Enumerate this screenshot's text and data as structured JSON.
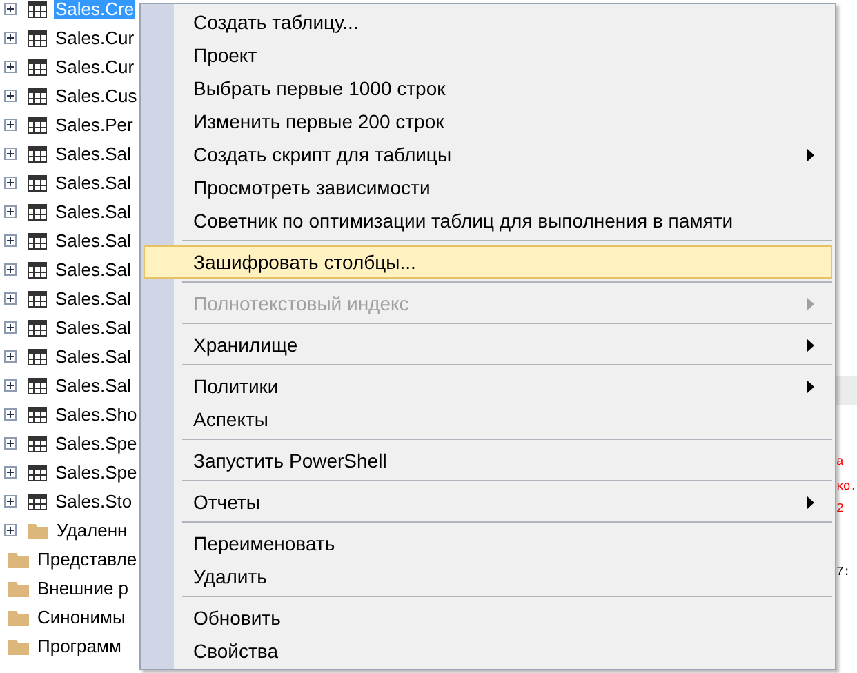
{
  "tree": {
    "nested_items": [
      {
        "label": "Sales.Cre",
        "kind": "table",
        "expandable": true,
        "selected": true
      },
      {
        "label": "Sales.Cur",
        "kind": "table",
        "expandable": true,
        "selected": false
      },
      {
        "label": "Sales.Cur",
        "kind": "table",
        "expandable": true,
        "selected": false
      },
      {
        "label": "Sales.Cus",
        "kind": "table",
        "expandable": true,
        "selected": false
      },
      {
        "label": "Sales.Per",
        "kind": "table",
        "expandable": true,
        "selected": false
      },
      {
        "label": "Sales.Sal",
        "kind": "table",
        "expandable": true,
        "selected": false
      },
      {
        "label": "Sales.Sal",
        "kind": "table",
        "expandable": true,
        "selected": false
      },
      {
        "label": "Sales.Sal",
        "kind": "table",
        "expandable": true,
        "selected": false
      },
      {
        "label": "Sales.Sal",
        "kind": "table",
        "expandable": true,
        "selected": false
      },
      {
        "label": "Sales.Sal",
        "kind": "table",
        "expandable": true,
        "selected": false
      },
      {
        "label": "Sales.Sal",
        "kind": "table",
        "expandable": true,
        "selected": false
      },
      {
        "label": "Sales.Sal",
        "kind": "table",
        "expandable": true,
        "selected": false
      },
      {
        "label": "Sales.Sal",
        "kind": "table",
        "expandable": true,
        "selected": false
      },
      {
        "label": "Sales.Sal",
        "kind": "table",
        "expandable": true,
        "selected": false
      },
      {
        "label": "Sales.Sho",
        "kind": "table",
        "expandable": true,
        "selected": false
      },
      {
        "label": "Sales.Spe",
        "kind": "table",
        "expandable": true,
        "selected": false
      },
      {
        "label": "Sales.Spe",
        "kind": "table",
        "expandable": true,
        "selected": false
      },
      {
        "label": "Sales.Sto",
        "kind": "table",
        "expandable": true,
        "selected": false
      },
      {
        "label": "Удаленн",
        "kind": "folder",
        "expandable": true,
        "selected": false
      }
    ],
    "items": [
      {
        "label": "Представле",
        "kind": "folder",
        "expandable": false,
        "selected": false
      },
      {
        "label": "Внешние р",
        "kind": "folder",
        "expandable": false,
        "selected": false
      },
      {
        "label": "Синонимы",
        "kind": "folder",
        "expandable": false,
        "selected": false
      },
      {
        "label": "Программ",
        "kind": "folder",
        "expandable": false,
        "selected": false
      }
    ]
  },
  "editor_fragments": [
    {
      "text": "а",
      "color": "#ff0000"
    },
    {
      "text": "ко.",
      "color": "#ff0000"
    },
    {
      "text": "2",
      "color": "#ff0000"
    },
    {
      "text": "7:",
      "color": "#000000"
    }
  ],
  "context_menu": [
    {
      "kind": "item",
      "label": "Создать таблицу...",
      "submenu": false,
      "disabled": false,
      "selected": false
    },
    {
      "kind": "item",
      "label": "Проект",
      "submenu": false,
      "disabled": false,
      "selected": false
    },
    {
      "kind": "item",
      "label": "Выбрать первые 1000 строк",
      "submenu": false,
      "disabled": false,
      "selected": false
    },
    {
      "kind": "item",
      "label": "Изменить первые 200 строк",
      "submenu": false,
      "disabled": false,
      "selected": false
    },
    {
      "kind": "item",
      "label": "Создать скрипт для таблицы",
      "submenu": true,
      "disabled": false,
      "selected": false
    },
    {
      "kind": "item",
      "label": "Просмотреть зависимости",
      "submenu": false,
      "disabled": false,
      "selected": false
    },
    {
      "kind": "item",
      "label": "Советник по оптимизации таблиц для выполнения в памяти",
      "submenu": false,
      "disabled": false,
      "selected": false
    },
    {
      "kind": "separator"
    },
    {
      "kind": "item",
      "label": "Зашифровать столбцы...",
      "submenu": false,
      "disabled": false,
      "selected": true
    },
    {
      "kind": "separator"
    },
    {
      "kind": "item",
      "label": "Полнотекстовый индекс",
      "submenu": true,
      "disabled": true,
      "selected": false
    },
    {
      "kind": "separator"
    },
    {
      "kind": "item",
      "label": "Хранилище",
      "submenu": true,
      "disabled": false,
      "selected": false
    },
    {
      "kind": "separator"
    },
    {
      "kind": "item",
      "label": "Политики",
      "submenu": true,
      "disabled": false,
      "selected": false
    },
    {
      "kind": "item",
      "label": "Аспекты",
      "submenu": false,
      "disabled": false,
      "selected": false
    },
    {
      "kind": "separator"
    },
    {
      "kind": "item",
      "label": "Запустить PowerShell",
      "submenu": false,
      "disabled": false,
      "selected": false
    },
    {
      "kind": "separator"
    },
    {
      "kind": "item",
      "label": "Отчеты",
      "submenu": true,
      "disabled": false,
      "selected": false
    },
    {
      "kind": "separator"
    },
    {
      "kind": "item",
      "label": "Переименовать",
      "submenu": false,
      "disabled": false,
      "selected": false
    },
    {
      "kind": "item",
      "label": "Удалить",
      "submenu": false,
      "disabled": false,
      "selected": false
    },
    {
      "kind": "separator"
    },
    {
      "kind": "item",
      "label": "Обновить",
      "submenu": false,
      "disabled": false,
      "selected": false
    },
    {
      "kind": "item",
      "label": "Свойства",
      "submenu": false,
      "disabled": false,
      "selected": false
    }
  ]
}
